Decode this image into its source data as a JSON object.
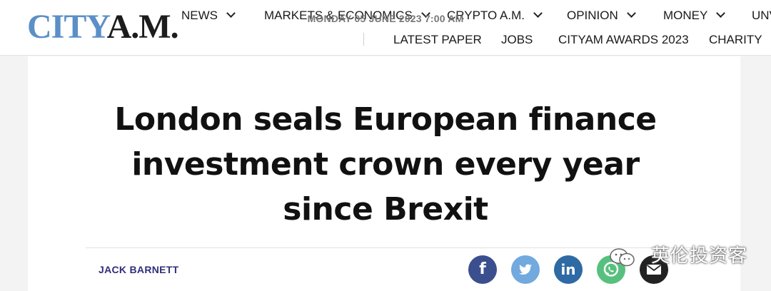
{
  "brand": {
    "logo_city": "CITY",
    "logo_am": "A.M.",
    "logo_color": "#5b8fc7"
  },
  "nav": {
    "primary": [
      {
        "label": "NEWS",
        "has_dropdown": true
      },
      {
        "label": "MARKETS & ECONOMICS",
        "has_dropdown": true
      },
      {
        "label": "CRYPTO A.M.",
        "has_dropdown": true
      },
      {
        "label": "OPINION",
        "has_dropdown": true
      },
      {
        "label": "MONEY",
        "has_dropdown": true
      },
      {
        "label": "UNV",
        "has_dropdown": false
      }
    ],
    "secondary": [
      {
        "label": "LATEST PAPER"
      },
      {
        "label": "JOBS"
      },
      {
        "label": "CITYAM AWARDS 2023"
      },
      {
        "label": "CHARITY"
      }
    ]
  },
  "article": {
    "date": "MONDAY 05 JUNE 2023 7:00 AM",
    "headline": "London seals European finance investment crown every year since Brexit",
    "author": "JACK BARNETT"
  },
  "share": {
    "facebook": {
      "icon": "facebook-icon",
      "glyph": "f",
      "color": "#3b4f8f"
    },
    "twitter": {
      "icon": "twitter-icon",
      "color": "#72a9de"
    },
    "linkedin": {
      "icon": "linkedin-icon",
      "glyph": "in",
      "color": "#2e6aa4"
    },
    "whatsapp": {
      "icon": "whatsapp-icon",
      "color": "#58c07f"
    },
    "email": {
      "icon": "email-icon",
      "color": "#222222"
    }
  },
  "watermark": {
    "text": "英伦投资客",
    "icon": "wechat-icon"
  }
}
